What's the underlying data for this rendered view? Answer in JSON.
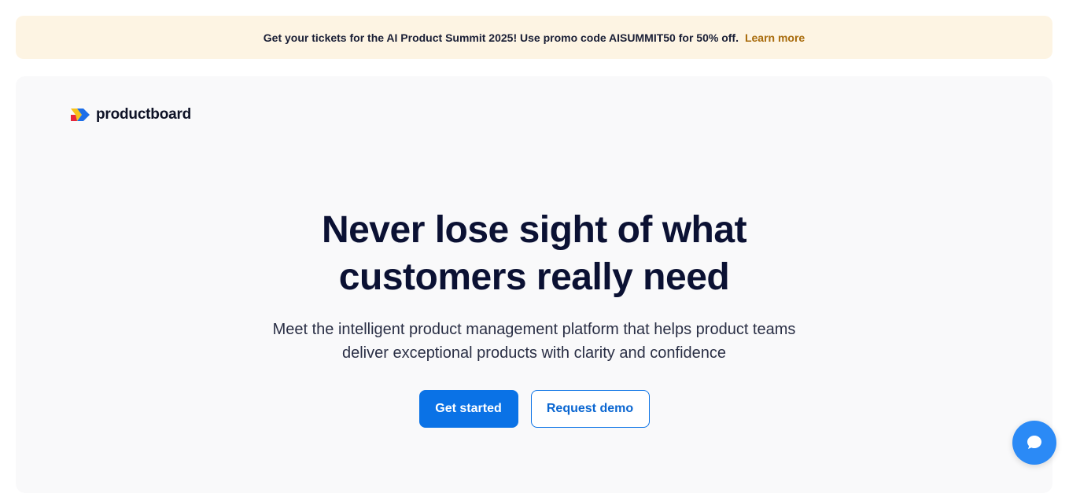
{
  "promo": {
    "text": "Get your tickets for the AI Product Summit 2025! Use promo code AISUMMIT50 for 50% off.",
    "link_label": "Learn more"
  },
  "brand": {
    "name": "productboard"
  },
  "hero": {
    "headline_line1": "Never lose sight of what",
    "headline_line2": "customers really need",
    "subheadline_line1": "Meet the intelligent product management platform that helps product teams",
    "subheadline_line2": "deliver exceptional products with clarity and confidence"
  },
  "cta": {
    "primary_label": "Get started",
    "secondary_label": "Request demo"
  },
  "chat": {
    "icon": "chat-bubble-icon"
  },
  "colors": {
    "accent": "#0a72e6",
    "banner_bg": "#fdf4e3",
    "link": "#a86b0c",
    "chat": "#2b8af6"
  }
}
